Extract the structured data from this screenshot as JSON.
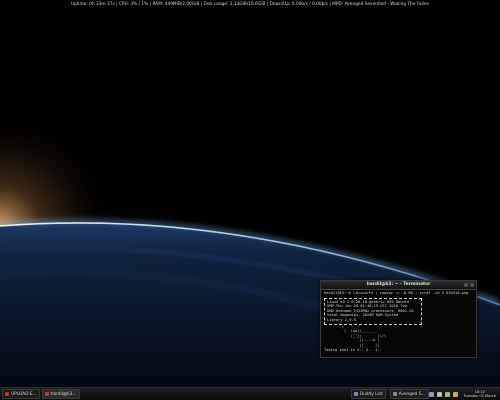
{
  "statusbar": {
    "uptime": "Uptime: 0h 33m 37s",
    "cpu": "CPU: 3% / 1%",
    "ram": "RAM: 449MiB/2.00GiB",
    "disk": "Disk usage: 2.13GiB/16.6GiB",
    "download": "Down/Up: 0.00b/s / 0.00b/s",
    "mpd": "MPD: Avenged Sevenfold - Waking The Fallen"
  },
  "terminal": {
    "title": "hardil@k3: ~ - Terminator",
    "prompt_line": "hardil@k3:~$ linuxinfo | cowsay -n -W 80 ; scrot -cd 5 020310.png",
    "info_lines": [
      "Linux k3 2.6.28-18-generic #59-Ubuntu",
      "SMP Thu Jan 28 01:40:19 UTC 2010 Two",
      "AMD Unknown 2412MHz processors, 9662.20",
      "total bogomips, 2024M RAM System",
      "Library 2.9.0"
    ],
    "cow_lines": [
      "        \\   ^__^",
      "         \\  (oo)\\_______",
      "            (__)\\       )\\/\\",
      "                ||----w |",
      "                ||     ||"
    ],
    "status_line": "Taking shot in 5.. 2.. 1.."
  },
  "taskbar": {
    "tasks": [
      {
        "label": "UPLOAD E...",
        "color": "#c0392b"
      },
      {
        "label": "hardil@k3...",
        "color": "#c0392b"
      },
      {
        "label": "Buddy List",
        "color": "#6d8fbf"
      },
      {
        "label": "Avenged S...",
        "color": "#8b8b8b"
      }
    ],
    "clock_time": "18:10",
    "clock_date": "Tuesday 02 March"
  },
  "colors": {
    "glow": "#f0b46a",
    "atmosphere": "#a9d8ff",
    "planet": "#0b1a2e"
  }
}
